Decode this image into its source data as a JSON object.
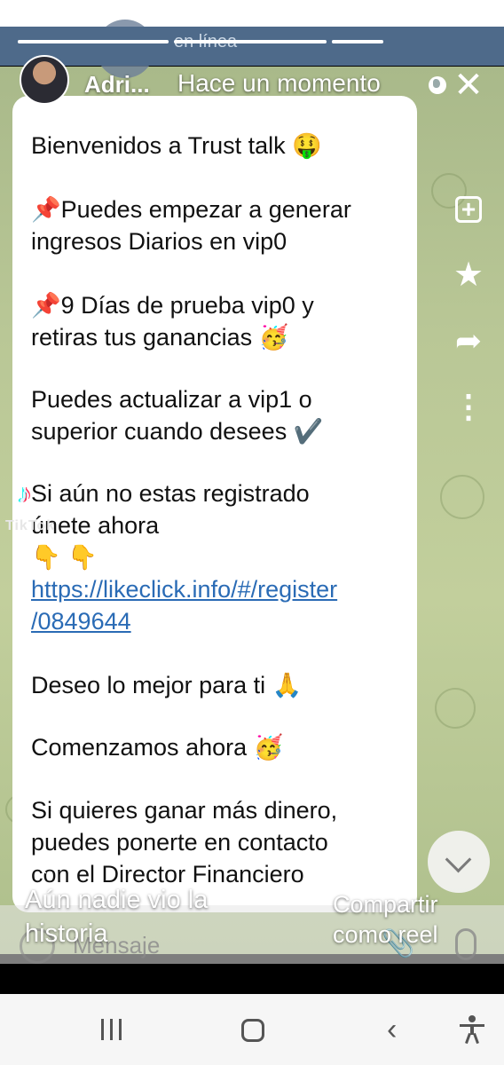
{
  "story": {
    "user_name": "Adri...",
    "time_ago": "Hace un momento",
    "progress": [
      1.0,
      1.0,
      1.0
    ],
    "viewers_text": "Aún nadie vio la\nhistoria",
    "share_reel_text": "Compartir\ncomo reel"
  },
  "telegram": {
    "status": "en línea",
    "input_placeholder": "Mensaje"
  },
  "message": {
    "line1": "Bienvenidos a Trust talk 🤑",
    "para1": "📌Puedes empezar a generar\ningresos Diarios en vip0",
    "para2": "📌9 Días de prueba vip0 y\nretiras tus ganancias 🥳",
    "para3": "Puedes actualizar a vip1 o\nsuperior cuando desees ✔️",
    "para4": "Si aún no estas registrado\núnete ahora",
    "emojis": "👇 👇",
    "link": "https://likeclick.info/#/register\n/0849644",
    "para5": "Deseo lo mejor para ti 🙏",
    "para6": "Comenzamos ahora 🥳",
    "para7": "Si quieres ganar más dinero,\npuedes ponerte en contacto\ncon el Director Financiero"
  },
  "tiktok": {
    "label": "TikTok"
  },
  "icons": {
    "close": "close-icon",
    "globe": "globe-icon",
    "add": "add-to-story-icon",
    "star": "star-icon",
    "share": "share-icon",
    "more": "more-icon"
  },
  "colors": {
    "link": "#2a6bb5",
    "header": "#4e6a8a",
    "chat_bg": "#b9c796"
  }
}
